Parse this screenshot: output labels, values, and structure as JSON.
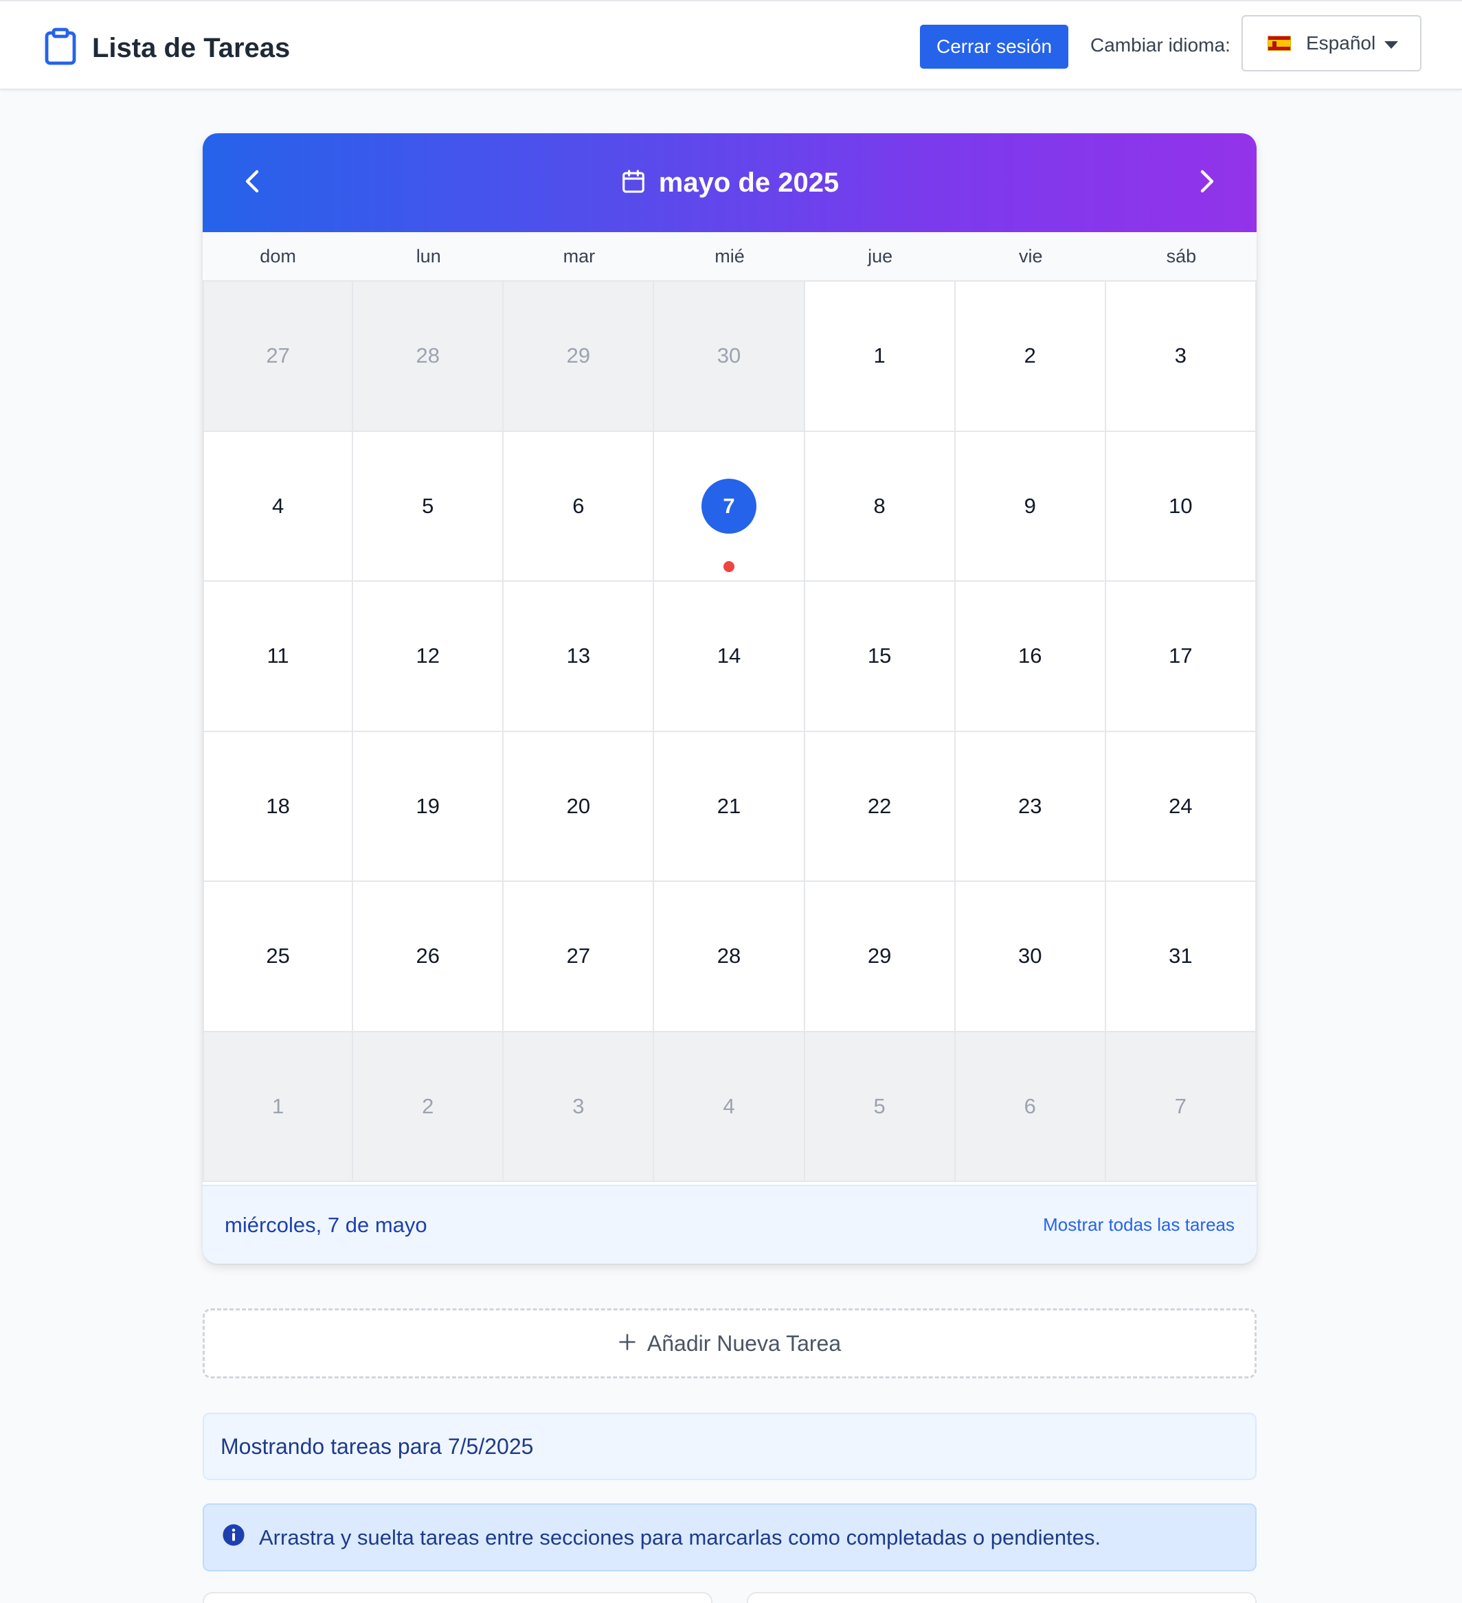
{
  "header": {
    "title": "Lista de Tareas",
    "logout_label": "Cerrar sesión",
    "language_label": "Cambiar idioma:",
    "language_selected": "Español",
    "accent_color": "#2563eb"
  },
  "calendar": {
    "title": "mayo de 2025",
    "weekdays": [
      "dom",
      "lun",
      "mar",
      "mié",
      "jue",
      "vie",
      "sáb"
    ],
    "days": [
      {
        "label": "27",
        "outside": true
      },
      {
        "label": "28",
        "outside": true
      },
      {
        "label": "29",
        "outside": true
      },
      {
        "label": "30",
        "outside": true
      },
      {
        "label": "1"
      },
      {
        "label": "2"
      },
      {
        "label": "3"
      },
      {
        "label": "4"
      },
      {
        "label": "5"
      },
      {
        "label": "6"
      },
      {
        "label": "7",
        "selected": true,
        "has_tasks": true
      },
      {
        "label": "8"
      },
      {
        "label": "9"
      },
      {
        "label": "10"
      },
      {
        "label": "11"
      },
      {
        "label": "12"
      },
      {
        "label": "13"
      },
      {
        "label": "14"
      },
      {
        "label": "15"
      },
      {
        "label": "16"
      },
      {
        "label": "17"
      },
      {
        "label": "18"
      },
      {
        "label": "19"
      },
      {
        "label": "20"
      },
      {
        "label": "21"
      },
      {
        "label": "22"
      },
      {
        "label": "23"
      },
      {
        "label": "24"
      },
      {
        "label": "25"
      },
      {
        "label": "26"
      },
      {
        "label": "27"
      },
      {
        "label": "28"
      },
      {
        "label": "29"
      },
      {
        "label": "30"
      },
      {
        "label": "31"
      },
      {
        "label": "1",
        "outside": true
      },
      {
        "label": "2",
        "outside": true
      },
      {
        "label": "3",
        "outside": true
      },
      {
        "label": "4",
        "outside": true
      },
      {
        "label": "5",
        "outside": true
      },
      {
        "label": "6",
        "outside": true
      },
      {
        "label": "7",
        "outside": true
      }
    ],
    "selected_date_text": "miércoles, 7 de mayo",
    "show_all_label": "Mostrar todas las tareas",
    "header_gradient": [
      "#2563eb",
      "#9333ea"
    ],
    "task_dot_color": "#ef4444"
  },
  "add_task": {
    "label": "Añadir Nueva Tarea"
  },
  "filter_banner": {
    "text": "Mostrando tareas para 7/5/2025"
  },
  "tip_banner": {
    "text": "Arrastra y suelta tareas entre secciones para marcarlas como completadas o pendientes."
  }
}
